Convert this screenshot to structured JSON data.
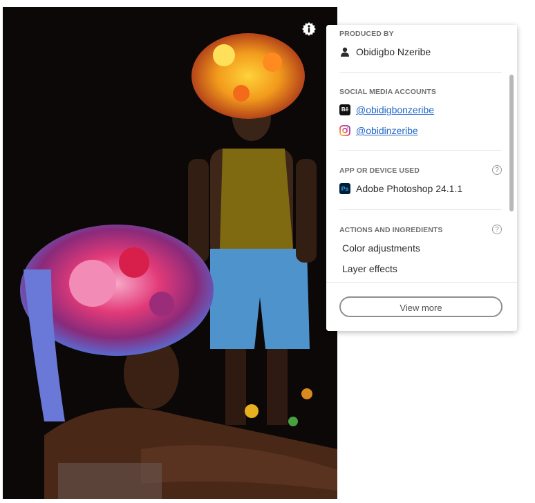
{
  "image": {
    "alt": "Photograph of two men wearing large flower headdresses against a black background"
  },
  "info_badge": {
    "icon": "info-icon"
  },
  "panel": {
    "produced_by": {
      "title": "PRODUCED BY",
      "icon": "person-icon",
      "name": "Obidigbo Nzeribe"
    },
    "social": {
      "title": "SOCIAL MEDIA ACCOUNTS",
      "accounts": [
        {
          "icon": "behance-icon",
          "icon_text": "Bē",
          "handle": "@obidigbonzeribe"
        },
        {
          "icon": "instagram-icon",
          "handle": "@obidinzeribe"
        }
      ]
    },
    "app": {
      "title": "APP OR DEVICE USED",
      "help": "?",
      "icon": "photoshop-icon",
      "icon_text": "Ps",
      "name": "Adobe Photoshop 24.1.1"
    },
    "actions": {
      "title": "ACTIONS AND INGREDIENTS",
      "help": "?",
      "items": [
        "Color adjustments",
        "Layer effects"
      ]
    },
    "view_more_label": "View more"
  },
  "colors": {
    "link": "#2066c8",
    "photoshop": "#001e36",
    "photoshop_text": "#31a8ff"
  }
}
